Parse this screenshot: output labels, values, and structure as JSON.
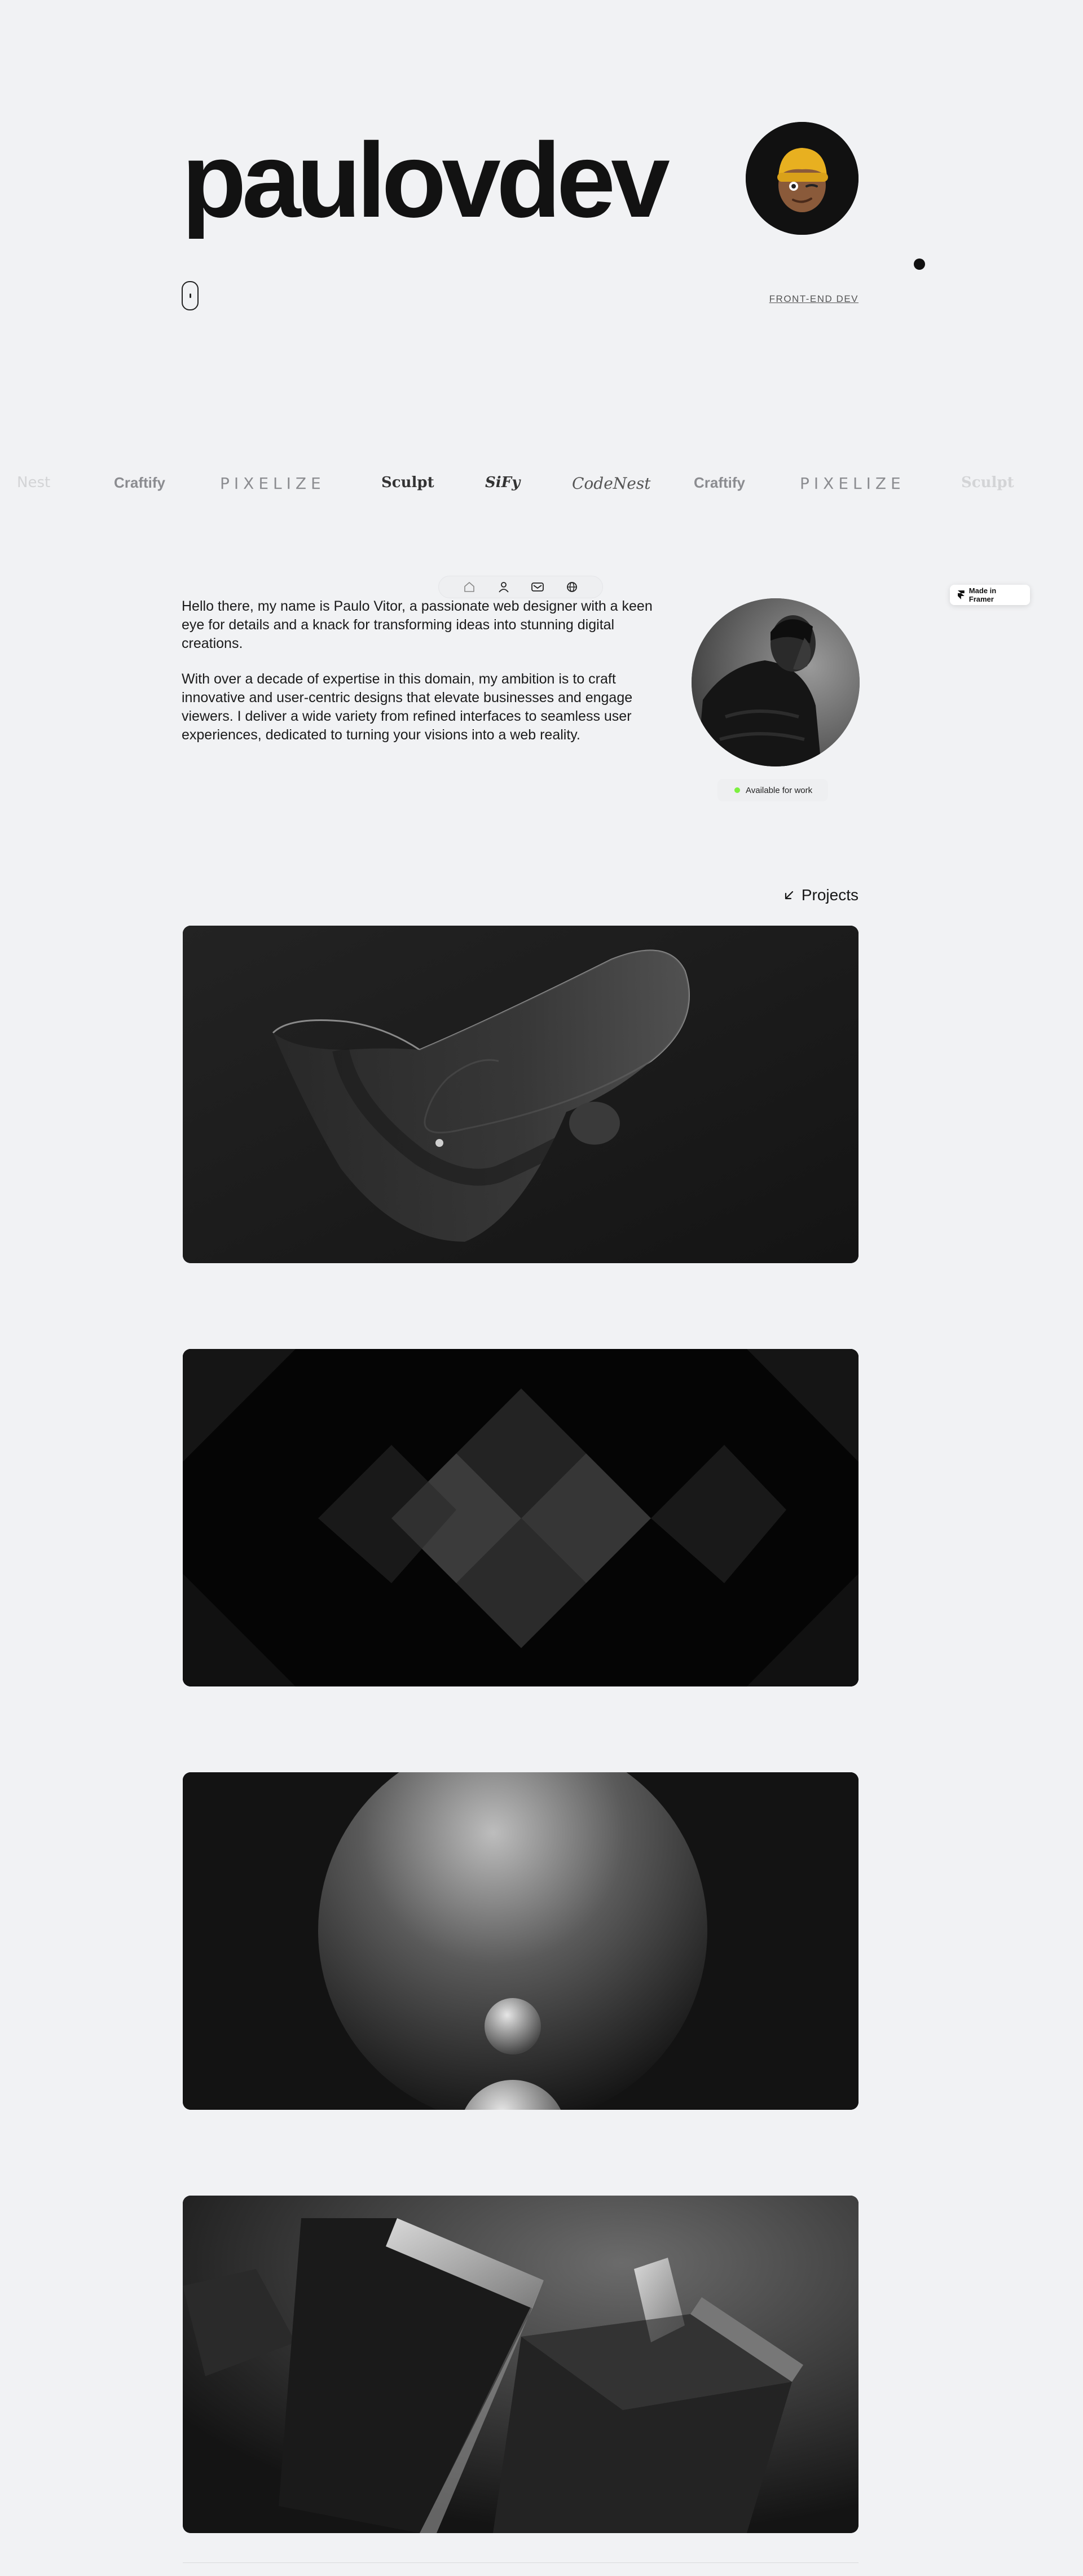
{
  "hero": {
    "brand": "paulovdev",
    "role_link": "FRONT-END DEV"
  },
  "marquee": {
    "logos": [
      {
        "label": "Nest"
      },
      {
        "label": "Craftify"
      },
      {
        "label": "PIXELIZE"
      },
      {
        "label": "Sculpt"
      },
      {
        "label": "SiFy"
      },
      {
        "label": "CodeNest"
      },
      {
        "label": "Craftify"
      },
      {
        "label": "PIXELIZE"
      },
      {
        "label": "Sculpt"
      }
    ]
  },
  "nav": {
    "items": [
      {
        "icon": "home-icon"
      },
      {
        "icon": "user-icon"
      },
      {
        "icon": "mail-icon"
      },
      {
        "icon": "globe-icon"
      }
    ]
  },
  "badge": {
    "framer": "Made in Framer"
  },
  "about": {
    "paragraph_1": "Hello there, my name is Paulo Vitor, a passionate web designer with a keen eye for details and a knack for transforming ideas into stunning digital creations.",
    "paragraph_2": "With over a decade of expertise in this domain, my ambition is to craft innovative and user-centric designs that elevate businesses and engage viewers. I deliver a wide variety from refined interfaces to seamless user experiences, dedicated to turning your visions into a web reality.",
    "status": "Available for work"
  },
  "projects": {
    "label": "Projects",
    "cards": [
      {
        "icon": "ribbon-sculpture-image"
      },
      {
        "icon": "diamond-pattern-image"
      },
      {
        "icon": "spheres-image"
      },
      {
        "icon": "blocks-image"
      }
    ]
  },
  "colors": {
    "background": "#f1f2f4",
    "text": "#161616",
    "accent_green": "#7cf03f",
    "card_dark": "#111111",
    "avatar_yellow": "#e8b020"
  }
}
